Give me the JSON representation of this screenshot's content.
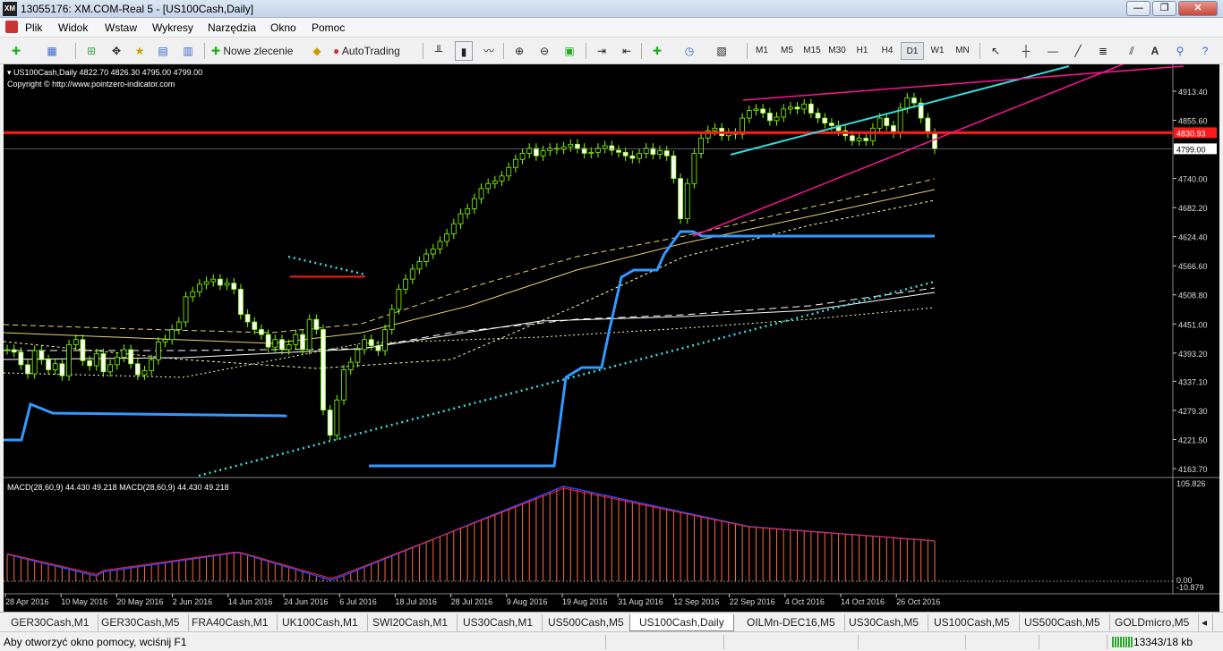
{
  "window": {
    "title": "13055176: XM.COM-Real 5 - [US100Cash,Daily]",
    "app_logo": "XM",
    "buttons": {
      "minimize": "—",
      "restore": "❐",
      "close": "✕"
    }
  },
  "menu": [
    "Plik",
    "Widok",
    "Wstaw",
    "Wykresy",
    "Narzędzia",
    "Okno",
    "Pomoc"
  ],
  "toolbar": {
    "new_order": "Nowe zlecenie",
    "autotrading": "AutoTrading",
    "timeframes": [
      "M1",
      "M5",
      "M15",
      "M30",
      "H1",
      "H4",
      "D1",
      "W1",
      "MN"
    ],
    "active_timeframe": "D1",
    "drawing": {
      "text_tool": "A"
    }
  },
  "chart": {
    "header": "US100Cash,Daily  4822.70 4826.30 4795.00 4799.00",
    "copyright": "Copyright © http://www.pointzero-indicator.com",
    "price_axis": [
      "4913.40",
      "4855.60",
      "4740.00",
      "4682.20",
      "4624.40",
      "4566.60",
      "4508.80",
      "4451.00",
      "4393.20",
      "4337.10",
      "4279.30",
      "4221.50",
      "4163.70"
    ],
    "price_markers": {
      "level": "4830.93",
      "current": "4799.00"
    },
    "date_axis": [
      "28 Apr 2016",
      "10 May 2016",
      "20 May 2016",
      "2 Jun 2016",
      "14 Jun 2016",
      "24 Jun 2016",
      "6 Jul 2016",
      "18 Jul 2016",
      "28 Jul 2016",
      "9 Aug 2016",
      "19 Aug 2016",
      "31 Aug 2016",
      "12 Sep 2016",
      "22 Sep 2016",
      "4 Oct 2016",
      "14 Oct 2016",
      "26 Oct 2016"
    ],
    "macd": {
      "label": "MACD(28,60,9) 44.430 49.218  MACD(28,60,9) 44.430 49.218",
      "axis": [
        "105.826",
        "0.00",
        "-10.879"
      ]
    },
    "colors": {
      "bg": "#000000",
      "candle": "#7fff00",
      "level": "#ff1a1a",
      "cyan": "#33dddd",
      "magenta": "#ff1493",
      "blue": "#3399ff"
    }
  },
  "tabs": [
    "GER30Cash,M1",
    "GER30Cash,M5",
    "FRA40Cash,M1",
    "UK100Cash,M1",
    "SWI20Cash,M1",
    "US30Cash,M1",
    "US500Cash,M5",
    "US100Cash,Daily",
    "OILMn-DEC16,M5",
    "US30Cash,M5",
    "US100Cash,M5",
    "US500Cash,M5",
    "GOLDmicro,M5"
  ],
  "active_tab": "US100Cash,Daily",
  "status": {
    "help": "Aby otworzyć okno pomocy, wciśnij F1",
    "traffic": "13343/18 kb"
  }
}
